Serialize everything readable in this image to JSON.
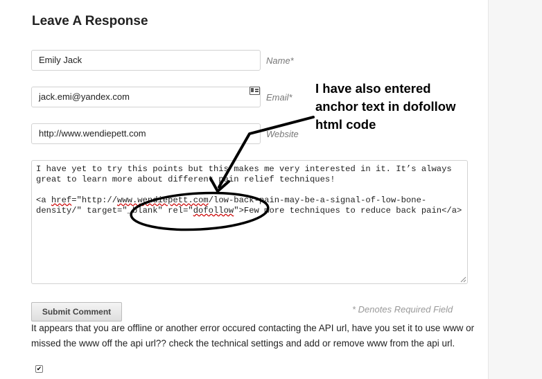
{
  "form": {
    "heading": "Leave A Response",
    "name": {
      "value": "Emily Jack",
      "label": "Name*"
    },
    "email": {
      "value": "jack.emi@yandex.com",
      "label": "Email*"
    },
    "website": {
      "value": "http://www.wendiepett.com",
      "label": "Website"
    },
    "comment": {
      "line1": "I have yet to try this points but this makes me very interested in it. It’s always great to learn more about different pain relief techniques!",
      "code_start": "<a ",
      "code_href": "href",
      "code_eq": "=\"http://",
      "code_domain": "www.wendiepett.com",
      "code_path": "/low-back-pain-may-be-a-signal-of-low-bone-density/\" target=\"_blank\" rel=\"",
      "code_rel": "dofollow",
      "code_end": "\">Few more techniques to reduce back pain</a>"
    },
    "submit_label": "Submit Comment",
    "required_note": "* Denotes Required Field",
    "error_message": "It appears that you are offline or another error occured contacting the API url, have you set it to use www or missed the www off the api url?? check the technical settings and add or remove www from the api url.",
    "checkbox_checked": true
  },
  "annotation": {
    "line1": "I have also entered",
    "line2": "anchor text in dofollow",
    "line3": "html code",
    "color": "#000000"
  },
  "icons": {
    "email_field_icon": "contact-card-icon"
  }
}
